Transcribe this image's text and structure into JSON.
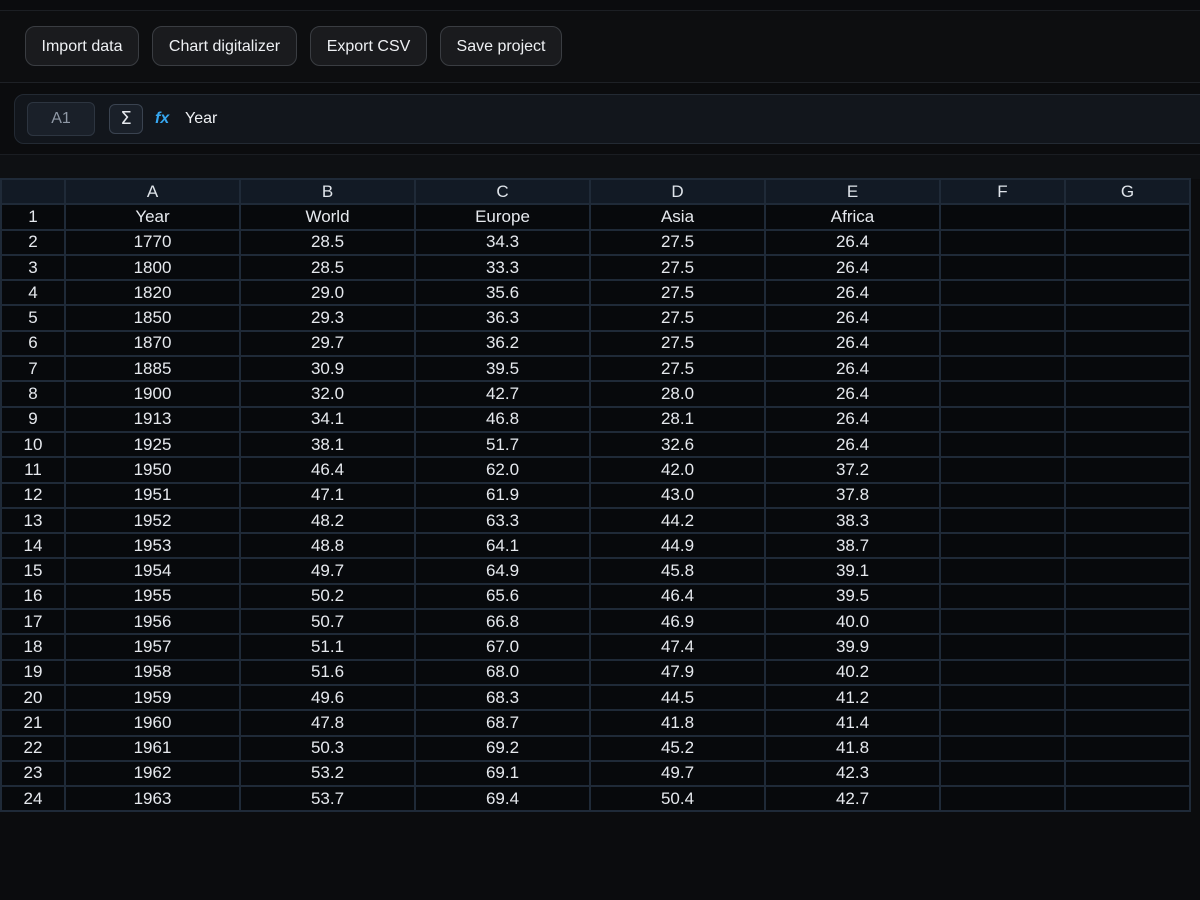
{
  "toolbar": {
    "buttons": [
      "Import data",
      "Chart digitalizer",
      "Export CSV",
      "Save project"
    ]
  },
  "formula_bar": {
    "cell_ref": "A1",
    "sigma": "Σ",
    "fx": "fx",
    "value": "Year"
  },
  "sheet": {
    "columns": [
      "A",
      "B",
      "C",
      "D",
      "E",
      "F",
      "G"
    ],
    "rows": [
      [
        "1",
        "Year",
        "World",
        "Europe",
        "Asia",
        "Africa",
        "",
        ""
      ],
      [
        "2",
        "1770",
        "28.5",
        "34.3",
        "27.5",
        "26.4",
        "",
        ""
      ],
      [
        "3",
        "1800",
        "28.5",
        "33.3",
        "27.5",
        "26.4",
        "",
        ""
      ],
      [
        "4",
        "1820",
        "29.0",
        "35.6",
        "27.5",
        "26.4",
        "",
        ""
      ],
      [
        "5",
        "1850",
        "29.3",
        "36.3",
        "27.5",
        "26.4",
        "",
        ""
      ],
      [
        "6",
        "1870",
        "29.7",
        "36.2",
        "27.5",
        "26.4",
        "",
        ""
      ],
      [
        "7",
        "1885",
        "30.9",
        "39.5",
        "27.5",
        "26.4",
        "",
        ""
      ],
      [
        "8",
        "1900",
        "32.0",
        "42.7",
        "28.0",
        "26.4",
        "",
        ""
      ],
      [
        "9",
        "1913",
        "34.1",
        "46.8",
        "28.1",
        "26.4",
        "",
        ""
      ],
      [
        "10",
        "1925",
        "38.1",
        "51.7",
        "32.6",
        "26.4",
        "",
        ""
      ],
      [
        "11",
        "1950",
        "46.4",
        "62.0",
        "42.0",
        "37.2",
        "",
        ""
      ],
      [
        "12",
        "1951",
        "47.1",
        "61.9",
        "43.0",
        "37.8",
        "",
        ""
      ],
      [
        "13",
        "1952",
        "48.2",
        "63.3",
        "44.2",
        "38.3",
        "",
        ""
      ],
      [
        "14",
        "1953",
        "48.8",
        "64.1",
        "44.9",
        "38.7",
        "",
        ""
      ],
      [
        "15",
        "1954",
        "49.7",
        "64.9",
        "45.8",
        "39.1",
        "",
        ""
      ],
      [
        "16",
        "1955",
        "50.2",
        "65.6",
        "46.4",
        "39.5",
        "",
        ""
      ],
      [
        "17",
        "1956",
        "50.7",
        "66.8",
        "46.9",
        "40.0",
        "",
        ""
      ],
      [
        "18",
        "1957",
        "51.1",
        "67.0",
        "47.4",
        "39.9",
        "",
        ""
      ],
      [
        "19",
        "1958",
        "51.6",
        "68.0",
        "47.9",
        "40.2",
        "",
        ""
      ],
      [
        "20",
        "1959",
        "49.6",
        "68.3",
        "44.5",
        "41.2",
        "",
        ""
      ],
      [
        "21",
        "1960",
        "47.8",
        "68.7",
        "41.8",
        "41.4",
        "",
        ""
      ],
      [
        "22",
        "1961",
        "50.3",
        "69.2",
        "45.2",
        "41.8",
        "",
        ""
      ],
      [
        "23",
        "1962",
        "53.2",
        "69.1",
        "49.7",
        "42.3",
        "",
        ""
      ],
      [
        "24",
        "1963",
        "53.7",
        "69.4",
        "50.4",
        "42.7",
        "",
        ""
      ]
    ]
  }
}
